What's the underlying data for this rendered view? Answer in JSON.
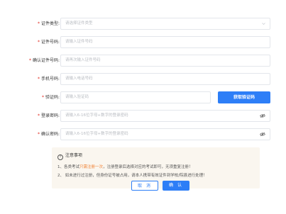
{
  "form": {
    "id_type": {
      "label": "证件类型:",
      "placeholder": "请选择证件类型"
    },
    "id_number": {
      "label": "证件号码:",
      "placeholder": "请输入证件号码"
    },
    "confirm_id_number": {
      "label": "确认证件号码:",
      "placeholder": "请再次输入证件号码"
    },
    "phone": {
      "label": "手机号码:",
      "placeholder": "请输入电话号码"
    },
    "code": {
      "label": "验证码:",
      "placeholder": "请输入验证码",
      "button": "获取验证码"
    },
    "password": {
      "label": "登录密码:",
      "placeholder": "请输入6-16位字母+数字的登录密码"
    },
    "confirm_password": {
      "label": "确认密码:",
      "placeholder": "请输入6-16位字母+数字的登录密码"
    },
    "required_mark": "*"
  },
  "notice": {
    "title": "注意事项",
    "line1_prefix": "1、各类考试",
    "line1_highlight": "只需注册一次",
    "line1_suffix": "，注册登录后选择对应的考试即可，无须重复注册！",
    "line2": "2、 如未进行过注册，但身份证号被占用，请本人携带有效证件到学校/院县进行处理！"
  },
  "actions": {
    "cancel": "取 消",
    "confirm": "确 认"
  },
  "colors": {
    "accent": "#2d7ef7",
    "required": "#e1251b",
    "highlight": "#f07d2d"
  }
}
